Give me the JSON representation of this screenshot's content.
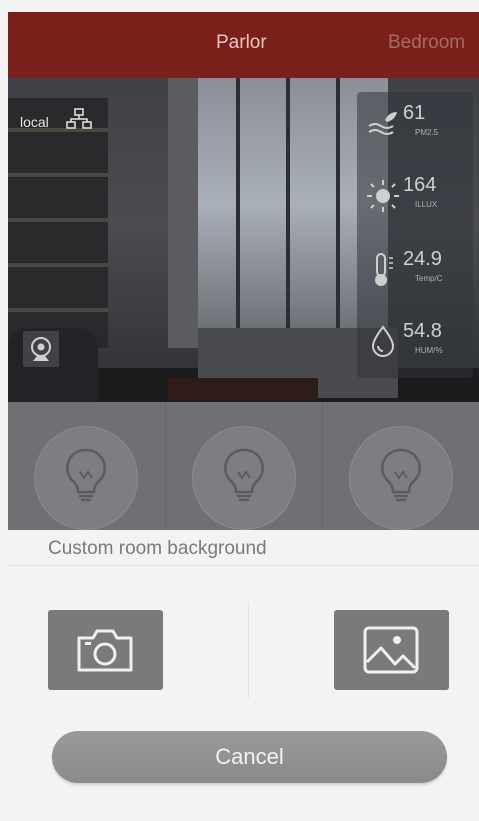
{
  "header": {
    "tabs": [
      {
        "label": "Parlor",
        "active": true
      },
      {
        "label": "Bedroom",
        "active": false
      }
    ],
    "background_color": "#7b1f1a"
  },
  "room": {
    "connection_label": "local",
    "sensors": [
      {
        "icon": "pm25-icon",
        "value": "61",
        "unit": "PM2.5"
      },
      {
        "icon": "sun-icon",
        "value": "164",
        "unit": "ILLUX"
      },
      {
        "icon": "thermometer-icon",
        "value": "24.9",
        "unit": "Temp/C"
      },
      {
        "icon": "humidity-icon",
        "value": "54.8",
        "unit": "HUM/%"
      }
    ]
  },
  "devices": [
    {
      "icon": "bulb-icon"
    },
    {
      "icon": "bulb-icon"
    },
    {
      "icon": "bulb-icon"
    }
  ],
  "sheet": {
    "title": "Custom room background",
    "camera_icon": "camera-icon",
    "gallery_icon": "image-gallery-icon",
    "cancel_label": "Cancel"
  }
}
